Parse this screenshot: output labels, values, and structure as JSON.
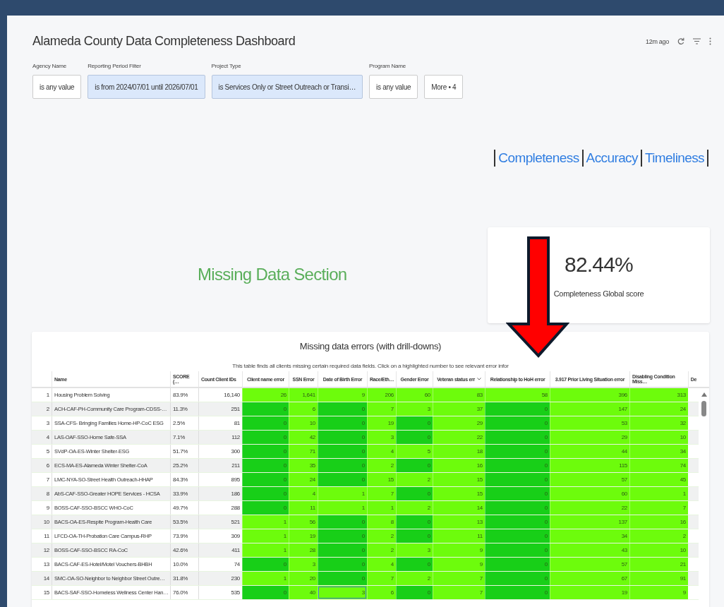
{
  "dashboard": {
    "title": "Alameda County Data Completeness Dashboard",
    "updated": "12m ago"
  },
  "filters": [
    {
      "label": "Agency Name",
      "value": "is any value",
      "active": false
    },
    {
      "label": "Reporting Period Filter",
      "value": "is from 2024/07/01 until 2026/07/01",
      "active": true
    },
    {
      "label": "Project Type",
      "value": "is Services Only or Street Outreach or Transi…",
      "active": true
    },
    {
      "label": "Program Name",
      "value": "is any value",
      "active": false
    }
  ],
  "more_filters": "More • 4",
  "nav_links": [
    "Completeness",
    "Accuracy",
    "Timeliness"
  ],
  "section_title": "Missing Data Section",
  "kpi": {
    "value": "82.44%",
    "label": "Completeness Global score"
  },
  "table": {
    "title": "Missing data errors (with drill-downs)",
    "description": "This table finds all clients missing certain required data fields. Click on a highlighted number to see relevant error infor",
    "columns": [
      "Name",
      "SCORE (…",
      "Count Client IDs",
      "Client name error",
      "SSN Error",
      "Date of Birth Error",
      "Race/Eth…",
      "Gender Error",
      "Veteran status err",
      "Relationship to HoH error",
      "3.917 Prior Living Situation error",
      "Disabling Condition Miss…",
      "De"
    ],
    "rows": [
      {
        "number": "1",
        "name": "Housing Problem Solving",
        "score": "83.9%",
        "count": "16,140",
        "errors": [
          {
            "text": "26",
            "color": "#6dfc0c",
            "selected": false
          },
          {
            "text": "1,641",
            "color": "#6dfc0c",
            "selected": false
          },
          {
            "text": "9",
            "color": "#6dfc0c",
            "selected": false
          },
          {
            "text": "206",
            "color": "#6dfc0c",
            "selected": false
          },
          {
            "text": "60",
            "color": "#6dfc0c",
            "selected": false
          },
          {
            "text": "83",
            "color": "#6dfc0c",
            "selected": false
          },
          {
            "text": "58",
            "color": "#6dfc0c",
            "selected": false
          },
          {
            "text": "396",
            "color": "#6dfc0c",
            "selected": false
          },
          {
            "text": "313",
            "color": "#6dfc0c",
            "selected": false
          }
        ]
      },
      {
        "number": "2",
        "name": "ACH-CAF-PH-Community Care Program-CDSS-…",
        "score": "11.3%",
        "count": "251",
        "errors": [
          {
            "text": "0",
            "color": "#18cf18",
            "selected": false
          },
          {
            "text": "6",
            "color": "#6dfc0c",
            "selected": false
          },
          {
            "text": "0",
            "color": "#18cf18",
            "selected": false
          },
          {
            "text": "7",
            "color": "#6dfc0c",
            "selected": false
          },
          {
            "text": "3",
            "color": "#6dfc0c",
            "selected": false
          },
          {
            "text": "37",
            "color": "#6dfc0c",
            "selected": false
          },
          {
            "text": "0",
            "color": "#18cf18",
            "selected": false
          },
          {
            "text": "147",
            "color": "#6dfc0c",
            "selected": false
          },
          {
            "text": "24",
            "color": "#6dfc0c",
            "selected": false
          }
        ]
      },
      {
        "number": "3",
        "name": "SSA-CFS- Bringing Families Home-HP-CoC ESG",
        "score": "2.5%",
        "count": "81",
        "errors": [
          {
            "text": "0",
            "color": "#18cf18",
            "selected": false
          },
          {
            "text": "10",
            "color": "#6dfc0c",
            "selected": false
          },
          {
            "text": "0",
            "color": "#18cf18",
            "selected": false
          },
          {
            "text": "19",
            "color": "#6dfc0c",
            "selected": false
          },
          {
            "text": "0",
            "color": "#18cf18",
            "selected": false
          },
          {
            "text": "29",
            "color": "#6dfc0c",
            "selected": false
          },
          {
            "text": "0",
            "color": "#18cf18",
            "selected": false
          },
          {
            "text": "53",
            "color": "#6dfc0c",
            "selected": false
          },
          {
            "text": "32",
            "color": "#6dfc0c",
            "selected": false
          }
        ]
      },
      {
        "number": "4",
        "name": "LAS-OAF-SSO-Home Safe-SSA",
        "score": "7.1%",
        "count": "112",
        "errors": [
          {
            "text": "0",
            "color": "#18cf18",
            "selected": false
          },
          {
            "text": "42",
            "color": "#6dfc0c",
            "selected": false
          },
          {
            "text": "0",
            "color": "#18cf18",
            "selected": false
          },
          {
            "text": "3",
            "color": "#6dfc0c",
            "selected": false
          },
          {
            "text": "0",
            "color": "#18cf18",
            "selected": false
          },
          {
            "text": "22",
            "color": "#6dfc0c",
            "selected": false
          },
          {
            "text": "0",
            "color": "#18cf18",
            "selected": false
          },
          {
            "text": "29",
            "color": "#6dfc0c",
            "selected": false
          },
          {
            "text": "10",
            "color": "#6dfc0c",
            "selected": false
          }
        ]
      },
      {
        "number": "5",
        "name": "SVdP-OA-ES-Winter Shelter-ESG",
        "score": "51.7%",
        "count": "300",
        "errors": [
          {
            "text": "0",
            "color": "#18cf18",
            "selected": false
          },
          {
            "text": "71",
            "color": "#6dfc0c",
            "selected": false
          },
          {
            "text": "0",
            "color": "#18cf18",
            "selected": false
          },
          {
            "text": "4",
            "color": "#6dfc0c",
            "selected": false
          },
          {
            "text": "5",
            "color": "#6dfc0c",
            "selected": false
          },
          {
            "text": "18",
            "color": "#6dfc0c",
            "selected": false
          },
          {
            "text": "0",
            "color": "#18cf18",
            "selected": false
          },
          {
            "text": "44",
            "color": "#6dfc0c",
            "selected": false
          },
          {
            "text": "34",
            "color": "#6dfc0c",
            "selected": false
          }
        ]
      },
      {
        "number": "6",
        "name": "ECS-MA-ES-Alameda Winter Shelter-CoA",
        "score": "25.2%",
        "count": "211",
        "errors": [
          {
            "text": "0",
            "color": "#18cf18",
            "selected": false
          },
          {
            "text": "35",
            "color": "#6dfc0c",
            "selected": false
          },
          {
            "text": "0",
            "color": "#18cf18",
            "selected": false
          },
          {
            "text": "2",
            "color": "#6dfc0c",
            "selected": false
          },
          {
            "text": "0",
            "color": "#18cf18",
            "selected": false
          },
          {
            "text": "16",
            "color": "#6dfc0c",
            "selected": false
          },
          {
            "text": "0",
            "color": "#18cf18",
            "selected": false
          },
          {
            "text": "115",
            "color": "#6dfc0c",
            "selected": false
          },
          {
            "text": "74",
            "color": "#6dfc0c",
            "selected": false
          }
        ]
      },
      {
        "number": "7",
        "name": "LMC-NYA-SO-Street Health Outreach-HHAP",
        "score": "84.3%",
        "count": "895",
        "errors": [
          {
            "text": "0",
            "color": "#18cf18",
            "selected": false
          },
          {
            "text": "24",
            "color": "#6dfc0c",
            "selected": false
          },
          {
            "text": "0",
            "color": "#18cf18",
            "selected": false
          },
          {
            "text": "15",
            "color": "#6dfc0c",
            "selected": false
          },
          {
            "text": "2",
            "color": "#6dfc0c",
            "selected": false
          },
          {
            "text": "15",
            "color": "#6dfc0c",
            "selected": false
          },
          {
            "text": "0",
            "color": "#18cf18",
            "selected": false
          },
          {
            "text": "57",
            "color": "#6dfc0c",
            "selected": false
          },
          {
            "text": "45",
            "color": "#6dfc0c",
            "selected": false
          }
        ]
      },
      {
        "number": "8",
        "name": "AbS-CAF-SSO-Greater HOPE Services - HCSA",
        "score": "33.9%",
        "count": "186",
        "errors": [
          {
            "text": "0",
            "color": "#18cf18",
            "selected": false
          },
          {
            "text": "4",
            "color": "#6dfc0c",
            "selected": false
          },
          {
            "text": "1",
            "color": "#6dfc0c",
            "selected": false
          },
          {
            "text": "7",
            "color": "#6dfc0c",
            "selected": false
          },
          {
            "text": "0",
            "color": "#18cf18",
            "selected": false
          },
          {
            "text": "15",
            "color": "#6dfc0c",
            "selected": false
          },
          {
            "text": "0",
            "color": "#18cf18",
            "selected": false
          },
          {
            "text": "60",
            "color": "#6dfc0c",
            "selected": false
          },
          {
            "text": "1",
            "color": "#6dfc0c",
            "selected": false
          }
        ]
      },
      {
        "number": "9",
        "name": "BOSS-CAF-SSO-BSCC WHO-CoC",
        "score": "49.7%",
        "count": "288",
        "errors": [
          {
            "text": "0",
            "color": "#18cf18",
            "selected": false
          },
          {
            "text": "11",
            "color": "#6dfc0c",
            "selected": false
          },
          {
            "text": "1",
            "color": "#6dfc0c",
            "selected": false
          },
          {
            "text": "1",
            "color": "#6dfc0c",
            "selected": false
          },
          {
            "text": "2",
            "color": "#6dfc0c",
            "selected": false
          },
          {
            "text": "14",
            "color": "#6dfc0c",
            "selected": false
          },
          {
            "text": "0",
            "color": "#18cf18",
            "selected": false
          },
          {
            "text": "22",
            "color": "#6dfc0c",
            "selected": false
          },
          {
            "text": "7",
            "color": "#6dfc0c",
            "selected": false
          }
        ]
      },
      {
        "number": "10",
        "name": "BACS-OA-ES-Respite Program-Health Care",
        "score": "53.5%",
        "count": "521",
        "errors": [
          {
            "text": "1",
            "color": "#6dfc0c",
            "selected": false
          },
          {
            "text": "56",
            "color": "#6dfc0c",
            "selected": false
          },
          {
            "text": "0",
            "color": "#18cf18",
            "selected": false
          },
          {
            "text": "8",
            "color": "#6dfc0c",
            "selected": false
          },
          {
            "text": "0",
            "color": "#18cf18",
            "selected": false
          },
          {
            "text": "13",
            "color": "#6dfc0c",
            "selected": false
          },
          {
            "text": "0",
            "color": "#18cf18",
            "selected": false
          },
          {
            "text": "137",
            "color": "#6dfc0c",
            "selected": false
          },
          {
            "text": "16",
            "color": "#6dfc0c",
            "selected": false
          }
        ]
      },
      {
        "number": "11",
        "name": "LFCD-OA-TH-Probation Care Campus-RHP",
        "score": "73.9%",
        "count": "309",
        "errors": [
          {
            "text": "1",
            "color": "#6dfc0c",
            "selected": false
          },
          {
            "text": "19",
            "color": "#6dfc0c",
            "selected": false
          },
          {
            "text": "0",
            "color": "#18cf18",
            "selected": false
          },
          {
            "text": "2",
            "color": "#6dfc0c",
            "selected": false
          },
          {
            "text": "0",
            "color": "#18cf18",
            "selected": false
          },
          {
            "text": "11",
            "color": "#6dfc0c",
            "selected": false
          },
          {
            "text": "0",
            "color": "#18cf18",
            "selected": false
          },
          {
            "text": "34",
            "color": "#6dfc0c",
            "selected": false
          },
          {
            "text": "2",
            "color": "#6dfc0c",
            "selected": false
          }
        ]
      },
      {
        "number": "12",
        "name": "BOSS-CAF-SSO-BSCC RA-CoC",
        "score": "42.6%",
        "count": "411",
        "errors": [
          {
            "text": "1",
            "color": "#6dfc0c",
            "selected": false
          },
          {
            "text": "28",
            "color": "#6dfc0c",
            "selected": false
          },
          {
            "text": "0",
            "color": "#18cf18",
            "selected": false
          },
          {
            "text": "2",
            "color": "#6dfc0c",
            "selected": false
          },
          {
            "text": "3",
            "color": "#6dfc0c",
            "selected": false
          },
          {
            "text": "9",
            "color": "#6dfc0c",
            "selected": false
          },
          {
            "text": "0",
            "color": "#18cf18",
            "selected": false
          },
          {
            "text": "43",
            "color": "#6dfc0c",
            "selected": false
          },
          {
            "text": "10",
            "color": "#6dfc0c",
            "selected": false
          }
        ]
      },
      {
        "number": "13",
        "name": "BACS-CAF-ES-Hotel/Motel Vouchers-BHBH",
        "score": "10.0%",
        "count": "74",
        "errors": [
          {
            "text": "0",
            "color": "#18cf18",
            "selected": false
          },
          {
            "text": "3",
            "color": "#6dfc0c",
            "selected": false
          },
          {
            "text": "0",
            "color": "#18cf18",
            "selected": false
          },
          {
            "text": "4",
            "color": "#6dfc0c",
            "selected": false
          },
          {
            "text": "0",
            "color": "#18cf18",
            "selected": false
          },
          {
            "text": "9",
            "color": "#6dfc0c",
            "selected": false
          },
          {
            "text": "0",
            "color": "#18cf18",
            "selected": false
          },
          {
            "text": "57",
            "color": "#6dfc0c",
            "selected": false
          },
          {
            "text": "21",
            "color": "#6dfc0c",
            "selected": false
          }
        ]
      },
      {
        "number": "14",
        "name": "SMC-OA-SO-Neighbor to Neighbor Street Outre…",
        "score": "31.8%",
        "count": "230",
        "errors": [
          {
            "text": "1",
            "color": "#6dfc0c",
            "selected": false
          },
          {
            "text": "20",
            "color": "#6dfc0c",
            "selected": false
          },
          {
            "text": "0",
            "color": "#18cf18",
            "selected": false
          },
          {
            "text": "7",
            "color": "#6dfc0c",
            "selected": false
          },
          {
            "text": "2",
            "color": "#6dfc0c",
            "selected": false
          },
          {
            "text": "7",
            "color": "#6dfc0c",
            "selected": false
          },
          {
            "text": "0",
            "color": "#18cf18",
            "selected": false
          },
          {
            "text": "67",
            "color": "#6dfc0c",
            "selected": false
          },
          {
            "text": "91",
            "color": "#6dfc0c",
            "selected": false
          }
        ]
      },
      {
        "number": "15",
        "name": "BACS-SAF-SSO-Homeless Wellness Center Han…",
        "score": "76.0%",
        "count": "535",
        "errors": [
          {
            "text": "0",
            "color": "#18cf18",
            "selected": false
          },
          {
            "text": "40",
            "color": "#6dfc0c",
            "selected": false
          },
          {
            "text": "3",
            "color": "#6dfc0c",
            "selected": true
          },
          {
            "text": "6",
            "color": "#6dfc0c",
            "selected": false
          },
          {
            "text": "0",
            "color": "#18cf18",
            "selected": false
          },
          {
            "text": "7",
            "color": "#6dfc0c",
            "selected": false
          },
          {
            "text": "0",
            "color": "#18cf18",
            "selected": false
          },
          {
            "text": "19",
            "color": "#6dfc0c",
            "selected": false
          },
          {
            "text": "9",
            "color": "#6dfc0c",
            "selected": false
          }
        ]
      }
    ]
  }
}
